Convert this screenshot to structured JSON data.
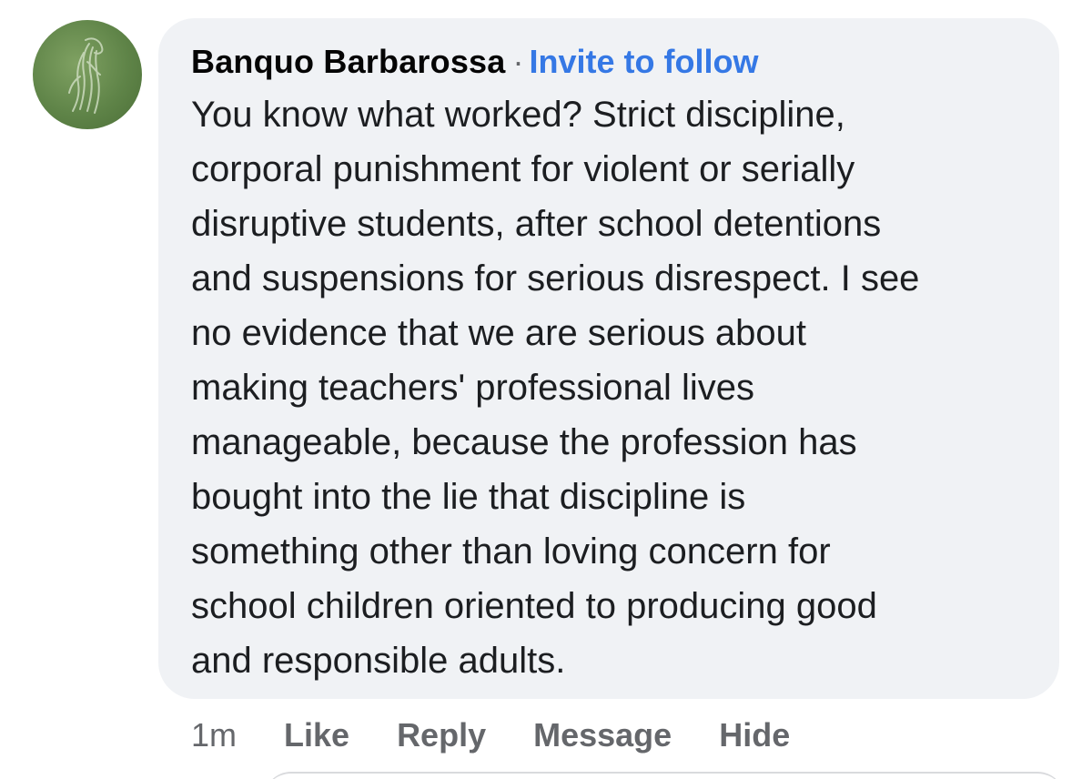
{
  "comment": {
    "author": "Banquo Barbarossa",
    "separator": "·",
    "follow_label": "Invite to follow",
    "text": "You know what worked? Strict discipline,\ncorporal punishment for violent or serially\ndisruptive students, after school detentions\nand suspensions for serious disrespect. I see\nno evidence that we are serious about\nmaking teachers' professional lives\nmanageable, because the profession has\nbought into the lie that discipline is\nsomething other than loving concern for\nschool children oriented to producing good\nand responsible adults.",
    "avatar_icon": "horse-avatar-icon"
  },
  "actions": {
    "time": "1m",
    "like": "Like",
    "reply": "Reply",
    "message": "Message",
    "hide": "Hide"
  },
  "colors": {
    "bubble": "#f0f2f5",
    "link": "#3578e5",
    "secondary_text": "#65676b",
    "avatar_green": "#5f8448"
  }
}
